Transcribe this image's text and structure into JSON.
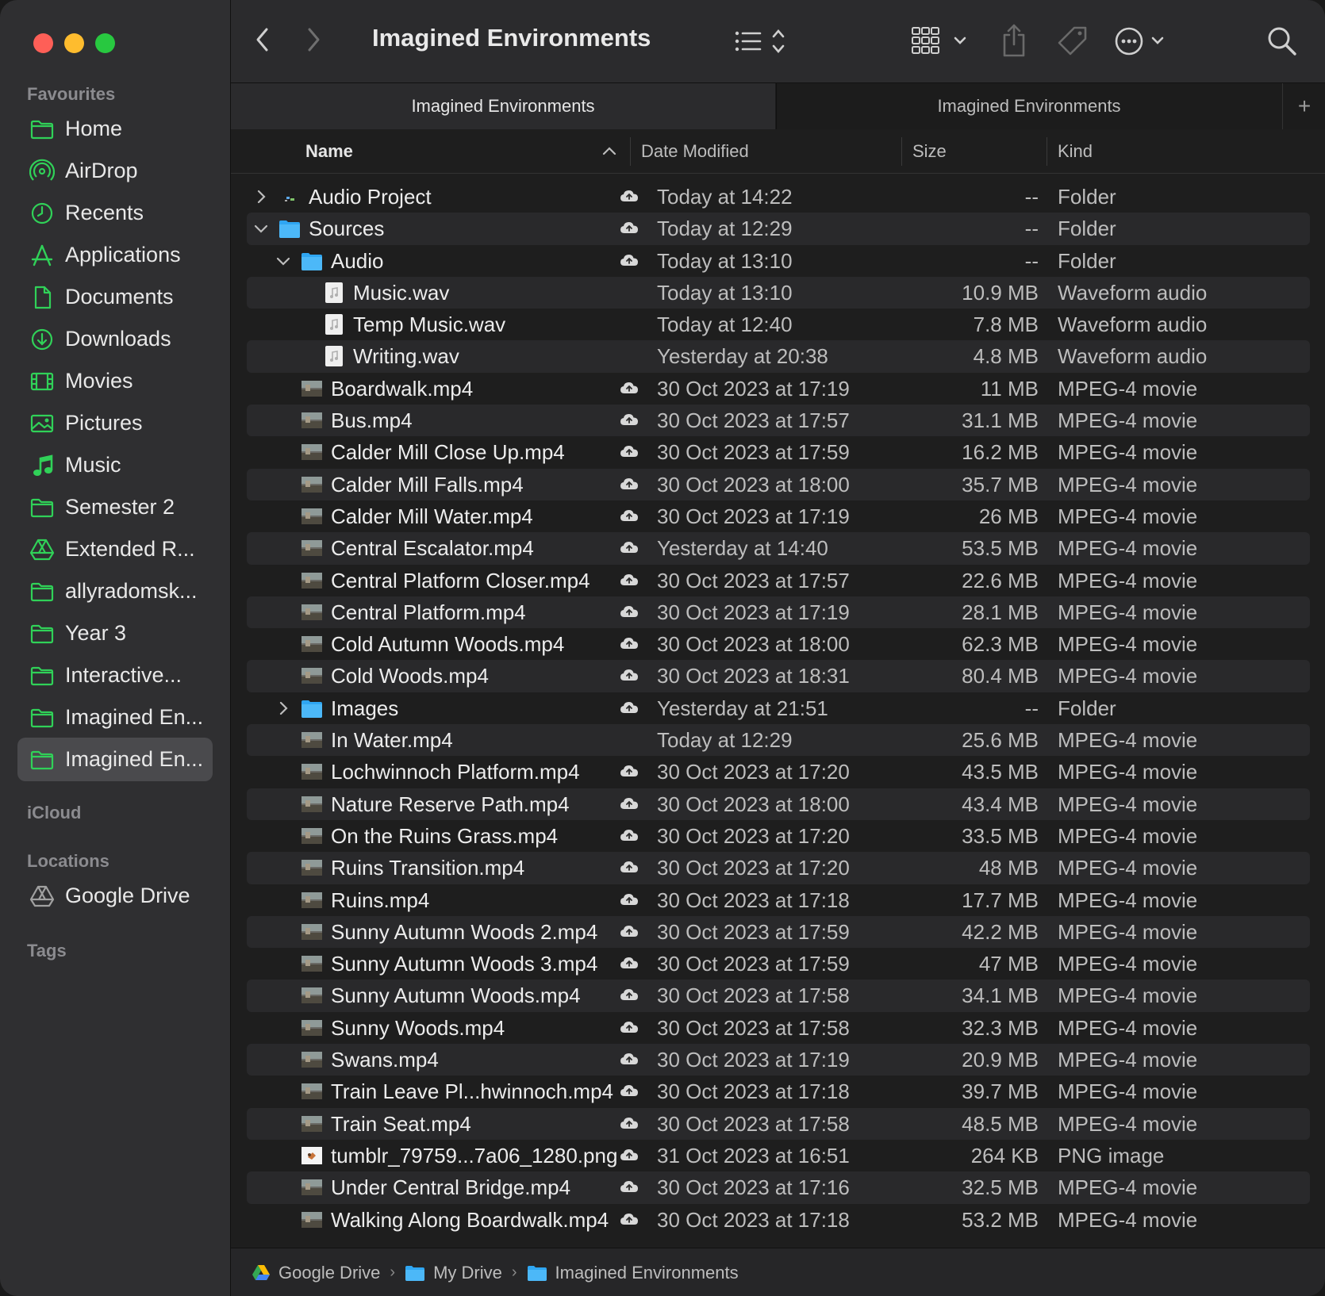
{
  "window": {
    "title": "Imagined Environments"
  },
  "toolbar": {
    "back_icon": "chevron-left-icon",
    "forward_icon": "chevron-right-icon",
    "title": "Imagined Environments",
    "view_icon": "list-view-icon",
    "group_icon": "grid-view-icon",
    "share_icon": "share-icon",
    "tag_icon": "tag-icon",
    "more_icon": "ellipsis-circle-icon",
    "search_icon": "search-icon"
  },
  "tabs": [
    {
      "label": "Imagined Environments",
      "active": true
    },
    {
      "label": "Imagined Environments",
      "active": false
    }
  ],
  "tab_add_label": "+",
  "sidebar": {
    "favourites_label": "Favourites",
    "favourites": [
      {
        "label": "Home",
        "icon": "folder-icon"
      },
      {
        "label": "AirDrop",
        "icon": "airdrop-icon"
      },
      {
        "label": "Recents",
        "icon": "clock-icon"
      },
      {
        "label": "Applications",
        "icon": "applications-icon"
      },
      {
        "label": "Documents",
        "icon": "document-icon"
      },
      {
        "label": "Downloads",
        "icon": "download-icon"
      },
      {
        "label": "Movies",
        "icon": "film-icon"
      },
      {
        "label": "Pictures",
        "icon": "photo-icon"
      },
      {
        "label": "Music",
        "icon": "music-note-icon"
      },
      {
        "label": "Semester 2",
        "icon": "folder-icon"
      },
      {
        "label": "Extended R...",
        "icon": "google-drive-icon"
      },
      {
        "label": "allyradomsk...",
        "icon": "folder-icon"
      },
      {
        "label": "Year 3",
        "icon": "folder-icon"
      },
      {
        "label": "Interactive...",
        "icon": "folder-icon"
      },
      {
        "label": "Imagined En...",
        "icon": "folder-icon"
      },
      {
        "label": "Imagined En...",
        "icon": "folder-icon",
        "selected": true
      }
    ],
    "icloud_label": "iCloud",
    "locations_label": "Locations",
    "locations": [
      {
        "label": "Google Drive",
        "icon": "google-drive-icon"
      }
    ],
    "tags_label": "Tags"
  },
  "columns": {
    "name": "Name",
    "date": "Date Modified",
    "size": "Size",
    "kind": "Kind"
  },
  "files": [
    {
      "name": "Audio Project",
      "date": "Today at 14:22",
      "size": "--",
      "kind": "Folder",
      "level": 0,
      "type": "project",
      "disclosure": "collapsed",
      "cloud": true
    },
    {
      "name": "Sources",
      "date": "Today at 12:29",
      "size": "--",
      "kind": "Folder",
      "level": 0,
      "type": "folder",
      "disclosure": "expanded",
      "cloud": true
    },
    {
      "name": "Audio",
      "date": "Today at 13:10",
      "size": "--",
      "kind": "Folder",
      "level": 1,
      "type": "folder",
      "disclosure": "expanded",
      "cloud": true
    },
    {
      "name": "Music.wav",
      "date": "Today at 13:10",
      "size": "10.9 MB",
      "kind": "Waveform audio",
      "level": 2,
      "type": "audio",
      "cloud": false
    },
    {
      "name": "Temp Music.wav",
      "date": "Today at 12:40",
      "size": "7.8 MB",
      "kind": "Waveform audio",
      "level": 2,
      "type": "audio",
      "cloud": false
    },
    {
      "name": "Writing.wav",
      "date": "Yesterday at 20:38",
      "size": "4.8 MB",
      "kind": "Waveform audio",
      "level": 2,
      "type": "audio",
      "cloud": false
    },
    {
      "name": "Boardwalk.mp4",
      "date": "30 Oct 2023 at 17:19",
      "size": "11 MB",
      "kind": "MPEG-4 movie",
      "level": 1,
      "type": "video",
      "cloud": true
    },
    {
      "name": "Bus.mp4",
      "date": "30 Oct 2023 at 17:57",
      "size": "31.1 MB",
      "kind": "MPEG-4 movie",
      "level": 1,
      "type": "video",
      "cloud": true
    },
    {
      "name": "Calder Mill Close Up.mp4",
      "date": "30 Oct 2023 at 17:59",
      "size": "16.2 MB",
      "kind": "MPEG-4 movie",
      "level": 1,
      "type": "video",
      "cloud": true
    },
    {
      "name": "Calder Mill Falls.mp4",
      "date": "30 Oct 2023 at 18:00",
      "size": "35.7 MB",
      "kind": "MPEG-4 movie",
      "level": 1,
      "type": "video",
      "cloud": true
    },
    {
      "name": "Calder Mill Water.mp4",
      "date": "30 Oct 2023 at 17:19",
      "size": "26 MB",
      "kind": "MPEG-4 movie",
      "level": 1,
      "type": "video",
      "cloud": true
    },
    {
      "name": "Central Escalator.mp4",
      "date": "Yesterday at 14:40",
      "size": "53.5 MB",
      "kind": "MPEG-4 movie",
      "level": 1,
      "type": "video",
      "cloud": true
    },
    {
      "name": "Central Platform Closer.mp4",
      "date": "30 Oct 2023 at 17:57",
      "size": "22.6 MB",
      "kind": "MPEG-4 movie",
      "level": 1,
      "type": "video",
      "cloud": true
    },
    {
      "name": "Central Platform.mp4",
      "date": "30 Oct 2023 at 17:19",
      "size": "28.1 MB",
      "kind": "MPEG-4 movie",
      "level": 1,
      "type": "video",
      "cloud": true
    },
    {
      "name": "Cold Autumn Woods.mp4",
      "date": "30 Oct 2023 at 18:00",
      "size": "62.3 MB",
      "kind": "MPEG-4 movie",
      "level": 1,
      "type": "video",
      "cloud": true
    },
    {
      "name": "Cold Woods.mp4",
      "date": "30 Oct 2023 at 18:31",
      "size": "80.4 MB",
      "kind": "MPEG-4 movie",
      "level": 1,
      "type": "video",
      "cloud": true
    },
    {
      "name": "Images",
      "date": "Yesterday at 21:51",
      "size": "--",
      "kind": "Folder",
      "level": 1,
      "type": "folder",
      "disclosure": "collapsed",
      "cloud": true
    },
    {
      "name": "In Water.mp4",
      "date": "Today at 12:29",
      "size": "25.6 MB",
      "kind": "MPEG-4 movie",
      "level": 1,
      "type": "video",
      "cloud": false
    },
    {
      "name": "Lochwinnoch Platform.mp4",
      "date": "30 Oct 2023 at 17:20",
      "size": "43.5 MB",
      "kind": "MPEG-4 movie",
      "level": 1,
      "type": "video",
      "cloud": true
    },
    {
      "name": "Nature Reserve Path.mp4",
      "date": "30 Oct 2023 at 18:00",
      "size": "43.4 MB",
      "kind": "MPEG-4 movie",
      "level": 1,
      "type": "video",
      "cloud": true
    },
    {
      "name": "On the Ruins Grass.mp4",
      "date": "30 Oct 2023 at 17:20",
      "size": "33.5 MB",
      "kind": "MPEG-4 movie",
      "level": 1,
      "type": "video",
      "cloud": true
    },
    {
      "name": "Ruins Transition.mp4",
      "date": "30 Oct 2023 at 17:20",
      "size": "48 MB",
      "kind": "MPEG-4 movie",
      "level": 1,
      "type": "video",
      "cloud": true
    },
    {
      "name": "Ruins.mp4",
      "date": "30 Oct 2023 at 17:18",
      "size": "17.7 MB",
      "kind": "MPEG-4 movie",
      "level": 1,
      "type": "video",
      "cloud": true
    },
    {
      "name": "Sunny Autumn Woods 2.mp4",
      "date": "30 Oct 2023 at 17:59",
      "size": "42.2 MB",
      "kind": "MPEG-4 movie",
      "level": 1,
      "type": "video",
      "cloud": true
    },
    {
      "name": "Sunny Autumn Woods 3.mp4",
      "date": "30 Oct 2023 at 17:59",
      "size": "47 MB",
      "kind": "MPEG-4 movie",
      "level": 1,
      "type": "video",
      "cloud": true
    },
    {
      "name": "Sunny Autumn Woods.mp4",
      "date": "30 Oct 2023 at 17:58",
      "size": "34.1 MB",
      "kind": "MPEG-4 movie",
      "level": 1,
      "type": "video",
      "cloud": true
    },
    {
      "name": "Sunny Woods.mp4",
      "date": "30 Oct 2023 at 17:58",
      "size": "32.3 MB",
      "kind": "MPEG-4 movie",
      "level": 1,
      "type": "video",
      "cloud": true
    },
    {
      "name": "Swans.mp4",
      "date": "30 Oct 2023 at 17:19",
      "size": "20.9 MB",
      "kind": "MPEG-4 movie",
      "level": 1,
      "type": "video",
      "cloud": true
    },
    {
      "name": "Train Leave Pl...hwinnoch.mp4",
      "date": "30 Oct 2023 at 17:18",
      "size": "39.7 MB",
      "kind": "MPEG-4 movie",
      "level": 1,
      "type": "video",
      "cloud": true
    },
    {
      "name": "Train Seat.mp4",
      "date": "30 Oct 2023 at 17:58",
      "size": "48.5 MB",
      "kind": "MPEG-4 movie",
      "level": 1,
      "type": "video",
      "cloud": true
    },
    {
      "name": "tumblr_79759...7a06_1280.png",
      "date": "31 Oct 2023 at 16:51",
      "size": "264 KB",
      "kind": "PNG image",
      "level": 1,
      "type": "image",
      "cloud": true
    },
    {
      "name": "Under Central Bridge.mp4",
      "date": "30 Oct 2023 at 17:16",
      "size": "32.5 MB",
      "kind": "MPEG-4 movie",
      "level": 1,
      "type": "video",
      "cloud": true
    },
    {
      "name": "Walking Along Boardwalk.mp4",
      "date": "30 Oct 2023 at 17:18",
      "size": "53.2 MB",
      "kind": "MPEG-4 movie",
      "level": 1,
      "type": "video",
      "cloud": true
    }
  ],
  "pathbar": [
    {
      "label": "Google Drive",
      "icon": "google-drive-icon"
    },
    {
      "label": "My Drive",
      "icon": "folder-icon"
    },
    {
      "label": "Imagined Environments",
      "icon": "folder-icon"
    }
  ],
  "colors": {
    "accent": "#30d158",
    "folder": "#2fa6f2",
    "selected_bg": "#4a4a4d"
  }
}
